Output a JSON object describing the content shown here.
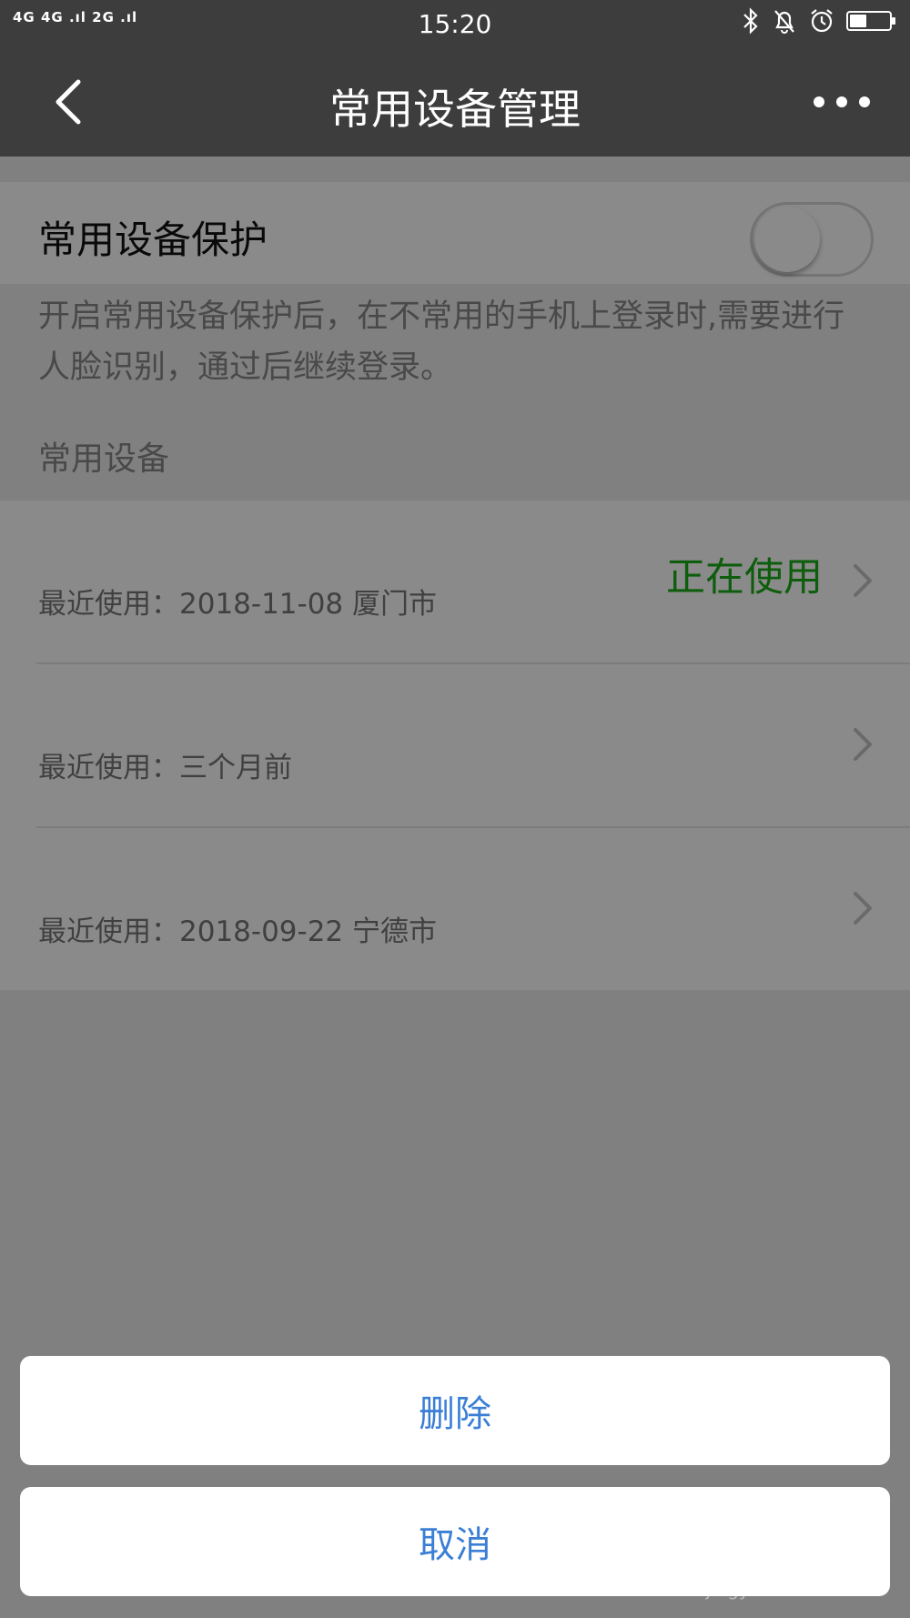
{
  "status_bar": {
    "signal_text": "4G 4G .ıl 2G .ıl",
    "time": "15:20",
    "icons": [
      "bluetooth-icon",
      "bell-off-icon",
      "alarm-icon",
      "battery-icon"
    ]
  },
  "nav": {
    "title": "常用设备管理",
    "back_icon": "chevron-left-icon",
    "more_icon": "more-dots-icon"
  },
  "protection": {
    "label": "常用设备保护",
    "enabled": false,
    "description": "开启常用设备保护后，在不常用的手机上登录时,需要进行人脸识别，通过后继续登录。"
  },
  "devices_section_label": "常用设备",
  "devices": [
    {
      "name": "",
      "recent": "最近使用：2018-11-08 厦门市",
      "status": "正在使用"
    },
    {
      "name": "",
      "recent": "最近使用：三个月前",
      "status": ""
    },
    {
      "name": "",
      "recent": "最近使用：2018-09-22 宁德市",
      "status": ""
    }
  ],
  "action_sheet": {
    "delete_label": "删除",
    "cancel_label": "取消"
  },
  "watermark": {
    "brand": "Baidu经验",
    "url": "jingyan.baidu.com"
  },
  "colors": {
    "navbar": "#3d3d3d",
    "active_status": "#1aad19",
    "action_text": "#3a7fd5"
  }
}
